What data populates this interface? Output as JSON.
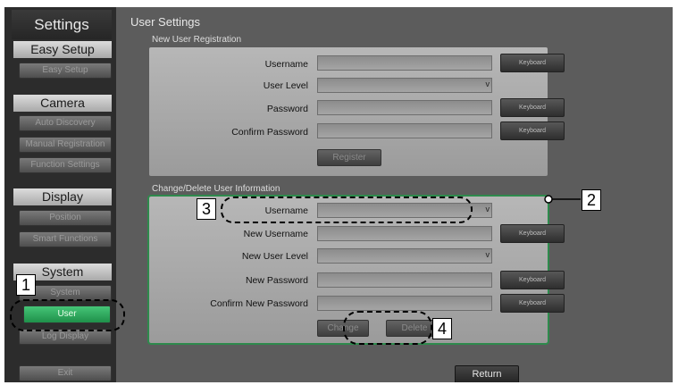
{
  "sidebar": {
    "title": "Settings",
    "sections": {
      "easy_setup": {
        "heading": "Easy Setup",
        "items": [
          "Easy Setup"
        ]
      },
      "camera": {
        "heading": "Camera",
        "items": [
          "Auto Discovery",
          "Manual Registration",
          "Function Settings"
        ]
      },
      "display": {
        "heading": "Display",
        "items": [
          "Position",
          "Smart Functions"
        ]
      },
      "system": {
        "heading": "System",
        "items": [
          "System",
          "User",
          "Log Display"
        ]
      }
    },
    "exit_label": "Exit"
  },
  "main": {
    "page_title": "User Settings",
    "registration": {
      "section_label": "New User Registration",
      "username_label": "Username",
      "user_level_label": "User Level",
      "password_label": "Password",
      "confirm_password_label": "Confirm Password",
      "register_label": "Register",
      "keyboard_label": "Keyboard"
    },
    "change_delete": {
      "section_label": "Change/Delete User Information",
      "username_label": "Username",
      "new_username_label": "New Username",
      "new_user_level_label": "New User Level",
      "new_password_label": "New Password",
      "confirm_new_password_label": "Confirm New Password",
      "change_label": "Change",
      "delete_label": "Delete",
      "keyboard_label": "Keyboard"
    },
    "return_label": "Return",
    "dropdown_arrow": "v"
  },
  "callouts": [
    "1",
    "2",
    "3",
    "4"
  ],
  "colors": {
    "active": "#2fae5e",
    "panel_border": "#2e8a4c",
    "background": "#5c5c5c"
  }
}
